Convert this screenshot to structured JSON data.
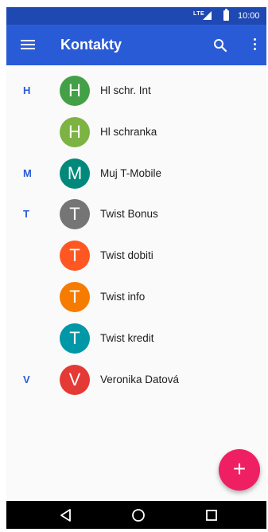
{
  "status_bar": {
    "network": "LTE",
    "time": "10:00"
  },
  "app_bar": {
    "title": "Kontakty",
    "icons": [
      "menu-icon",
      "search-icon",
      "more-vert-icon"
    ]
  },
  "contacts": [
    {
      "section": "H",
      "initial": "H",
      "name": "Hl schr. Int",
      "color": "#43a047"
    },
    {
      "section": "",
      "initial": "H",
      "name": "Hl schranka",
      "color": "#7cb342"
    },
    {
      "section": "M",
      "initial": "M",
      "name": "Muj T-Mobile",
      "color": "#00897b"
    },
    {
      "section": "T",
      "initial": "T",
      "name": "Twist Bonus",
      "color": "#757575"
    },
    {
      "section": "",
      "initial": "T",
      "name": "Twist dobiti",
      "color": "#ff5722"
    },
    {
      "section": "",
      "initial": "T",
      "name": "Twist info",
      "color": "#f57c00"
    },
    {
      "section": "",
      "initial": "T",
      "name": "Twist kredit",
      "color": "#0097a7"
    },
    {
      "section": "V",
      "initial": "V",
      "name": "Veronika Datová",
      "color": "#e53935"
    }
  ],
  "fab": {
    "icon": "add-icon",
    "symbol": "+"
  },
  "nav_bar": {
    "icons": [
      "back-icon",
      "home-icon",
      "recents-icon"
    ]
  },
  "colors": {
    "status_bar": "#1e48b2",
    "app_bar": "#2a5bd7",
    "section_letter": "#2a5bd7",
    "fab": "#ef1f63",
    "background": "#fafafa"
  }
}
